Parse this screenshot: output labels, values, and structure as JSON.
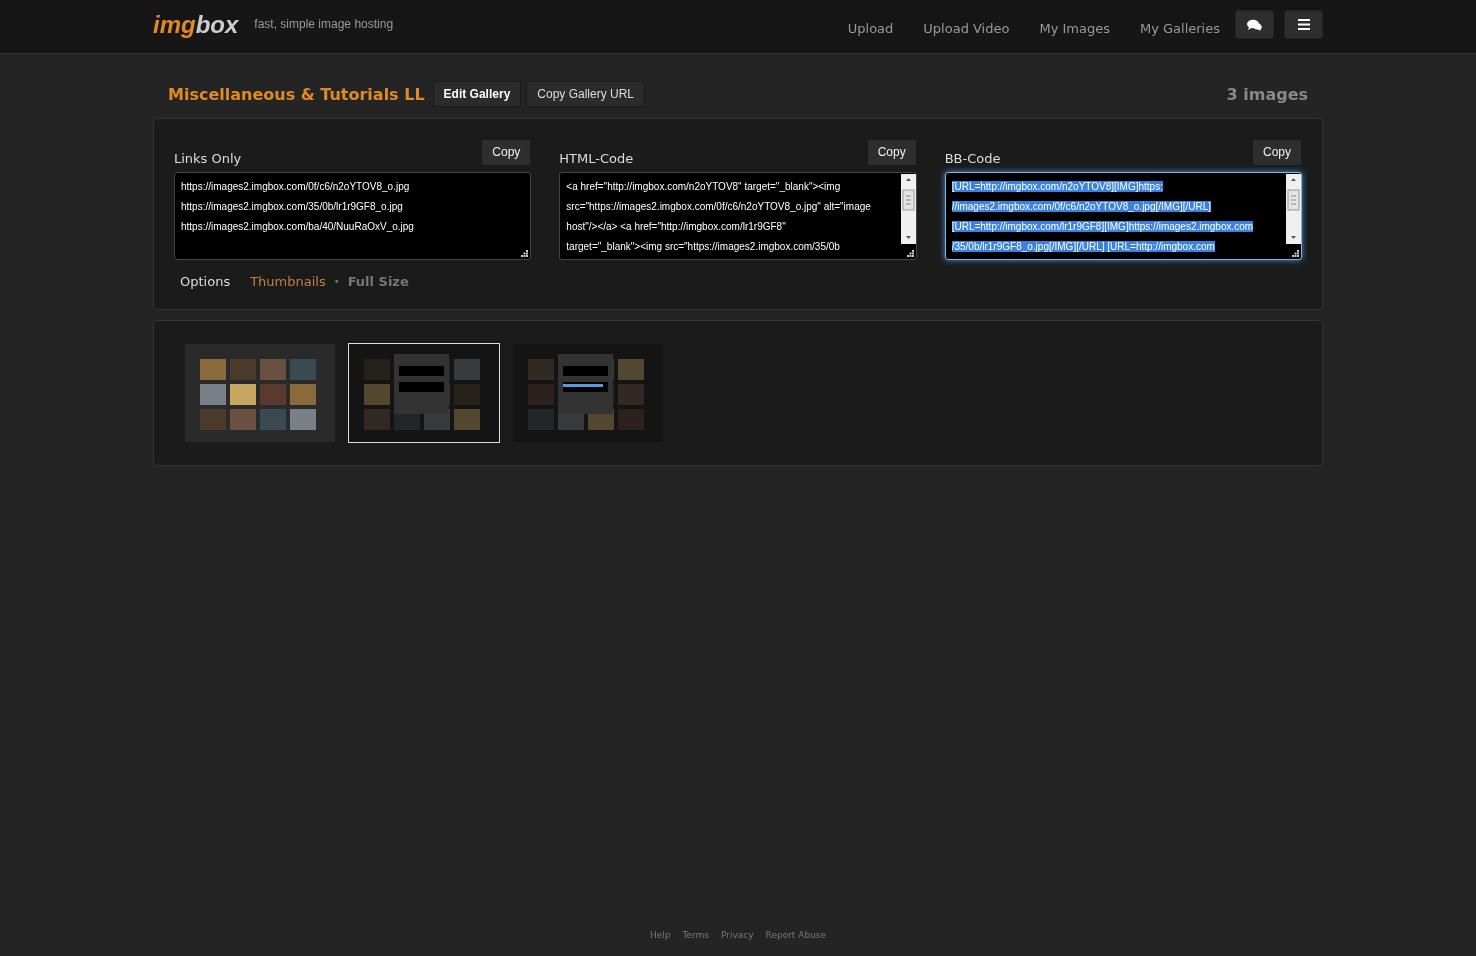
{
  "header": {
    "logo": {
      "part_1": "img",
      "part_2": "box"
    },
    "tagline": "fast, simple image hosting",
    "nav": [
      "Upload",
      "Upload Video",
      "My Images",
      "My Galleries"
    ]
  },
  "gallery": {
    "title": "Miscellaneous & Tutorials LL",
    "buttons": [
      {
        "label": "Edit Gallery",
        "bold": true
      },
      {
        "label": "Copy Gallery URL",
        "bold": false
      }
    ],
    "count": "3 images"
  },
  "code_boxes": [
    {
      "label": "Links Only",
      "button": "Copy",
      "focused": false,
      "scrollbar": false,
      "lines": [
        "https://images2.imgbox.com/0f/c6/n2oYTOV8_o.jpg",
        "https://images2.imgbox.com/35/0b/lr1r9GF8_o.jpg",
        "https://images2.imgbox.com/ba/40/NuuRaOxV_o.jpg"
      ]
    },
    {
      "label": "HTML-Code",
      "button": "Copy",
      "focused": false,
      "scrollbar": true,
      "lines": [
        "<a href=\"http://imgbox.com/n2oYTOV8\" target=\"_blank\"><img",
        "src=\"https://images2.imgbox.com/0f/c6/n2oYTOV8_o.jpg\" alt=\"image",
        "host\"/></a> <a href=\"http://imgbox.com/lr1r9GF8\"",
        "target=\"_blank\"><img src=\"https://images2.imgbox.com/35/0b"
      ]
    },
    {
      "label": "BB-Code",
      "button": "Copy",
      "focused": true,
      "scrollbar": true,
      "lines": [
        "[URL=http://imgbox.com/n2oYTOV8][IMG]https:",
        "//images2.imgbox.com/0f/c6/n2oYTOV8_o.jpg[/IMG][/URL]",
        "[URL=http://imgbox.com/lr1r9GF8][IMG]https://images2.imgbox.com",
        "/35/0b/lr1r9GF8_o.jpg[/IMG][/URL] [URL=http://imgbox.com"
      ]
    }
  ],
  "options": {
    "label": "Options",
    "separator": "•",
    "items": [
      {
        "label": "Thumbnails",
        "selected": true
      },
      {
        "label": "Full Size",
        "selected": false
      }
    ]
  },
  "thumbnails": [
    {
      "kind": "picture",
      "selected": false
    },
    {
      "kind": "picture",
      "selected": true
    },
    {
      "kind": "picture",
      "selected": false
    }
  ],
  "footer": [
    "Help",
    "Terms",
    "Privacy",
    "Report Abuse"
  ]
}
